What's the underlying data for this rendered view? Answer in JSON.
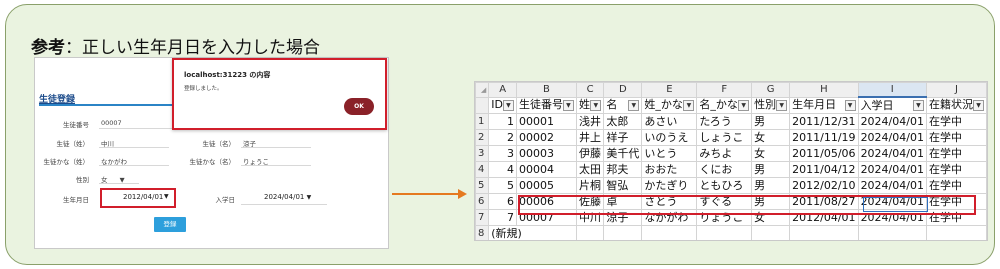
{
  "heading": {
    "label": "参考",
    "sep": "：",
    "text": "正しい生年月日を入力した場合"
  },
  "form": {
    "title": "生徒登録",
    "fields": {
      "student_no": {
        "label": "生徒番号",
        "value": "00007"
      },
      "last_name": {
        "label": "生徒（姓）",
        "value": "中川"
      },
      "first_name": {
        "label": "生徒（名）",
        "value": "涼子"
      },
      "last_kana": {
        "label": "生徒かな（姓）",
        "value": "なかがわ"
      },
      "first_kana": {
        "label": "生徒かな（名）",
        "value": "りょうこ"
      },
      "gender": {
        "label": "性別",
        "value": "女"
      },
      "birth": {
        "label": "生年月日",
        "value": "2012/04/01"
      },
      "admission": {
        "label": "入学日",
        "value": "2024/04/01"
      }
    },
    "register_button": "登録"
  },
  "dialog": {
    "title": "localhost:31223 の内容",
    "message": "登録しました。",
    "ok": "OK"
  },
  "sheet": {
    "col_letters": [
      "A",
      "B",
      "C",
      "D",
      "E",
      "F",
      "G",
      "H",
      "I",
      "J"
    ],
    "headers": [
      "ID",
      "生徒番号",
      "姓",
      "名",
      "姓_かな",
      "名_かな",
      "性別",
      "生年月日",
      "入学日",
      "在籍状況"
    ],
    "rows": [
      [
        "1",
        "1",
        "00001",
        "浅井",
        "太郎",
        "あさい",
        "たろう",
        "男",
        "2011/12/31",
        "2024/04/01",
        "在学中"
      ],
      [
        "2",
        "2",
        "00002",
        "井上",
        "祥子",
        "いのうえ",
        "しょうこ",
        "女",
        "2011/11/19",
        "2024/04/01",
        "在学中"
      ],
      [
        "3",
        "3",
        "00003",
        "伊藤",
        "美千代",
        "いとう",
        "みちよ",
        "女",
        "2011/05/06",
        "2024/04/01",
        "在学中"
      ],
      [
        "4",
        "4",
        "00004",
        "太田",
        "邦夫",
        "おおた",
        "くにお",
        "男",
        "2011/04/12",
        "2024/04/01",
        "在学中"
      ],
      [
        "5",
        "5",
        "00005",
        "片桐",
        "智弘",
        "かたぎり",
        "ともひろ",
        "男",
        "2012/02/10",
        "2024/04/01",
        "在学中"
      ],
      [
        "6",
        "6",
        "00006",
        "佐藤",
        "卓",
        "さとう",
        "すぐる",
        "男",
        "2011/08/27",
        "2024/04/01",
        "在学中"
      ],
      [
        "7",
        "7",
        "00007",
        "中川",
        "涼子",
        "なかがわ",
        "りょうこ",
        "女",
        "2012/04/01",
        "2024/04/01",
        "在学中"
      ]
    ],
    "new_row": {
      "num": "8",
      "label": "(新規)"
    }
  },
  "colors": {
    "panel_bg": "#eaf3e0",
    "highlight": "#d11e2b",
    "arrow": "#e57920",
    "button": "#2d9fdc",
    "ok_button": "#8a2128"
  }
}
